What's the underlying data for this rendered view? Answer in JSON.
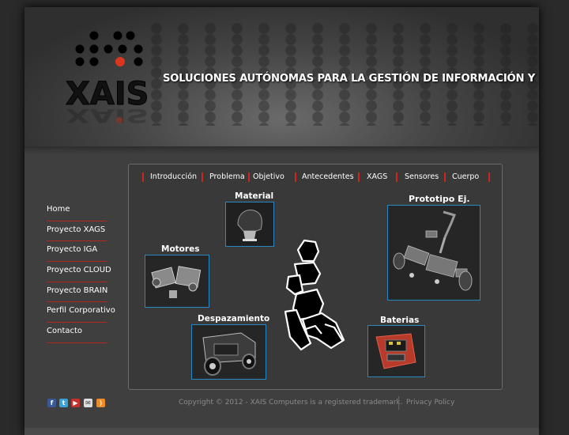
{
  "header": {
    "logo_text": "XAIS",
    "tagline": "SOLUCIONES AUTÓNOMAS PARA LA GESTIÓN DE INFORMACIÓN Y SERVICIOS"
  },
  "tabs": [
    "Introducción",
    "Problema",
    "Objetivo",
    "Antecedentes",
    "XAGS",
    "Sensores",
    "Cuerpo"
  ],
  "sidebar": {
    "items": [
      "Home",
      "Proyecto XAGS",
      "Proyecto IGA",
      "Proyecto CLOUD",
      "Proyecto BRAIN",
      "Perfil Corporativo",
      "Contacto"
    ]
  },
  "content": {
    "captions": {
      "material": "Material",
      "prototipo": "Prototipo Ej.",
      "motores": "Motores",
      "desplazamiento": "Despazamiento",
      "baterias": "Baterias"
    }
  },
  "footer": {
    "social_icons": [
      "facebook-icon",
      "twitter-icon",
      "youtube-icon",
      "email-icon",
      "rss-icon"
    ],
    "copyright": "Copyright © 2012 - XAIS Computers is a registered trademark.",
    "privacy": "Privacy Policy"
  },
  "colors": {
    "accent_red": "#c8281e",
    "thumb_border": "#2a87c2",
    "page_bg": "#3f3f3f"
  }
}
